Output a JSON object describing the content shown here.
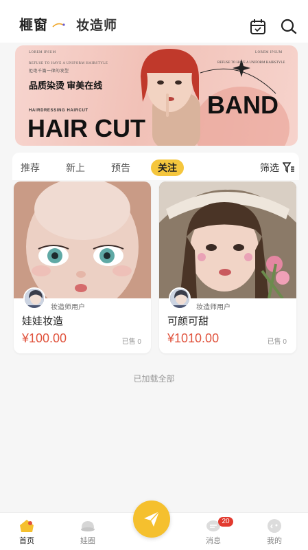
{
  "header": {
    "brand": "榧窗",
    "title": "妆造师"
  },
  "banner": {
    "lorem_left": "LOREM IPSUM",
    "refuse_left": "REFUSE TO HAVE A UNIFORM HAIRSTYLE",
    "small_cn": "拒绝千篇一律的发型",
    "slogan": "品质染烫 审美在线",
    "sub": "HAIRDRESSING HAIRCUT",
    "headline": "HAIR CUT",
    "band": "BAND",
    "lorem_right": "LOREM IPSUM",
    "refuse_right": "REFUSE TO HAVE A UNIFORM HAIRSTYLE"
  },
  "tabs": {
    "items": [
      "推荐",
      "新上",
      "预告",
      "关注"
    ],
    "active": "关注",
    "filter": "筛选"
  },
  "cards": [
    {
      "author": "妆造师用户",
      "title": "娃娃妆造",
      "price": "¥100.00",
      "sold": "已售 0"
    },
    {
      "author": "妆造师用户",
      "title": "可颜可甜",
      "price": "¥1010.00",
      "sold": "已售 0"
    }
  ],
  "footer_text": "已加载全部",
  "tabbar": {
    "items": [
      {
        "label": "首页",
        "icon": "home-icon"
      },
      {
        "label": "娃圈",
        "icon": "community-icon"
      },
      {
        "label": "消息",
        "icon": "message-icon"
      },
      {
        "label": "我的",
        "icon": "profile-icon"
      }
    ],
    "center_icon": "send-icon",
    "badge": "20"
  },
  "colors": {
    "accent": "#f5c02e",
    "price": "#e0533d",
    "badge": "#e23a2f"
  }
}
